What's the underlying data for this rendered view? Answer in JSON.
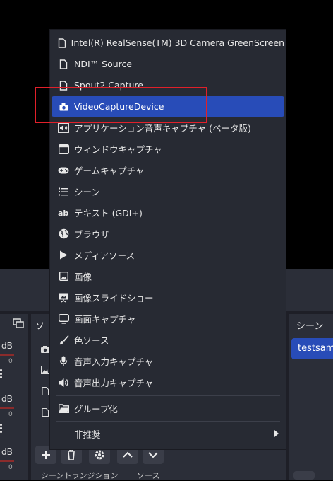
{
  "context_menu": {
    "items": [
      {
        "label": "Intel(R) RealSense(TM) 3D Camera GreenScreen",
        "icon": "file-icon"
      },
      {
        "label": "NDI™ Source",
        "icon": "file-icon"
      },
      {
        "label": "Spout2 Capture",
        "icon": "file-icon"
      },
      {
        "label": "VideoCaptureDevice",
        "icon": "camera-icon",
        "selected": true
      },
      {
        "label": "アプリケーション音声キャプチャ (ベータ版)",
        "icon": "app-audio-icon"
      },
      {
        "label": "ウィンドウキャプチャ",
        "icon": "window-icon"
      },
      {
        "label": "ゲームキャプチャ",
        "icon": "gamepad-icon"
      },
      {
        "label": "シーン",
        "icon": "list-icon"
      },
      {
        "label": "テキスト (GDI+)",
        "icon": "text-icon"
      },
      {
        "label": "ブラウザ",
        "icon": "globe-icon"
      },
      {
        "label": "メディアソース",
        "icon": "play-icon"
      },
      {
        "label": "画像",
        "icon": "image-icon"
      },
      {
        "label": "画像スライドショー",
        "icon": "slideshow-icon"
      },
      {
        "label": "画面キャプチャ",
        "icon": "monitor-icon"
      },
      {
        "label": "色ソース",
        "icon": "brush-icon"
      },
      {
        "label": "音声入力キャプチャ",
        "icon": "microphone-icon"
      },
      {
        "label": "音声出力キャプチャ",
        "icon": "speaker-icon"
      }
    ],
    "group": {
      "label": "グループ化",
      "icon": "folder-icon"
    },
    "deprecated": {
      "label": "非推奨"
    }
  },
  "mixer": {
    "channels": [
      {
        "db": "dB",
        "sub": "0"
      },
      {
        "db": "dB",
        "sub": "0"
      },
      {
        "db": "dB",
        "sub": "0"
      }
    ]
  },
  "sources_dock": {
    "header": "ソ"
  },
  "scenes_dock": {
    "header": "シーン",
    "items": [
      {
        "label": "testsample"
      }
    ]
  },
  "bottom_tabs": {
    "left": "シーントランジション",
    "right": "ソース"
  },
  "colors": {
    "accent": "#284cb8",
    "highlight_box": "#e0202a",
    "menu_bg": "#272a33",
    "panel_bg": "#2b2e38"
  }
}
